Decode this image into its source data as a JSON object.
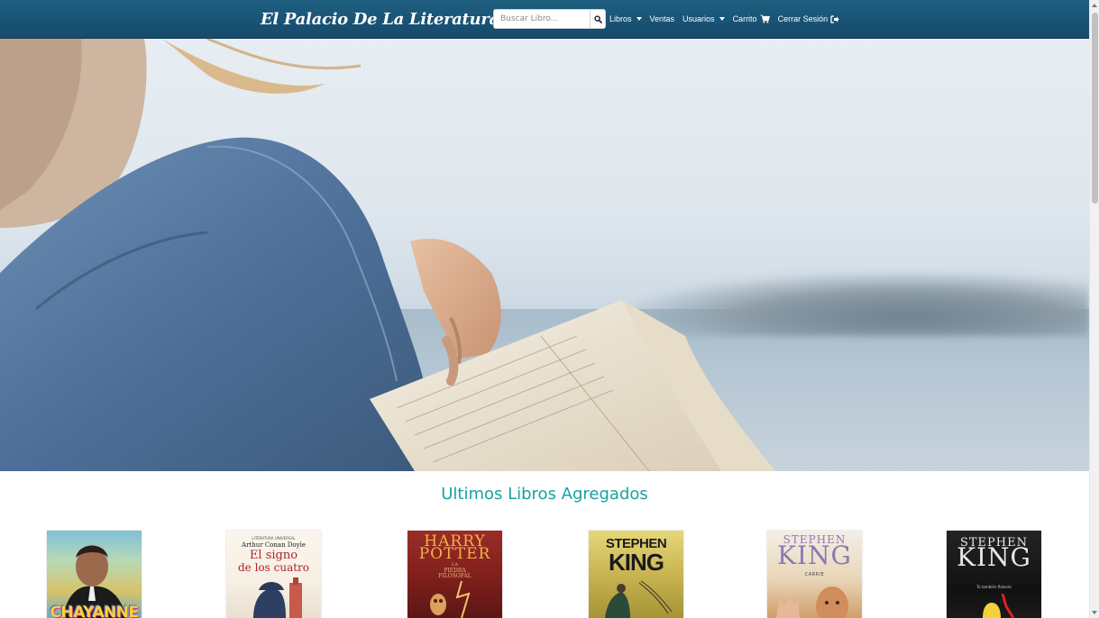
{
  "header": {
    "brand": "El Palacio De La Literatura",
    "search": {
      "placeholder": "Buscar Libro..."
    },
    "nav": [
      {
        "label": "Libros",
        "dropdown": true
      },
      {
        "label": "Ventas",
        "dropdown": false
      },
      {
        "label": "Usuarios",
        "dropdown": true
      },
      {
        "label": "Carrito",
        "icon": "cart-icon"
      },
      {
        "label": "Cerrar Sesión",
        "icon": "sign-out-icon"
      }
    ]
  },
  "main": {
    "section_title": "Ultimos Libros Agregados",
    "books": [
      {
        "cover_text": "CHAYANNE"
      },
      {
        "cover_series": "LITERATURA UNIVERSAL",
        "cover_author": "Arthur Conan Doyle",
        "cover_title_1": "El signo",
        "cover_title_2": "de los cuatro"
      },
      {
        "cover_title_1": "HARRY",
        "cover_title_2": "POTTER",
        "cover_subtitle_1": "LA",
        "cover_subtitle_2": "PIEDRA",
        "cover_subtitle_3": "FILOSOFAL"
      },
      {
        "cover_author_1": "STEPHEN",
        "cover_author_2": "KING"
      },
      {
        "cover_author_1": "STEPHEN",
        "cover_author_2": "KING",
        "cover_title": "CARRIE"
      },
      {
        "cover_author_1": "STEPHEN",
        "cover_author_2": "KING",
        "cover_tagline": "Tú también flotarás"
      }
    ]
  },
  "colors": {
    "navbar": "#195274",
    "accent": "#17a2a0",
    "text_light": "#ffffff"
  }
}
